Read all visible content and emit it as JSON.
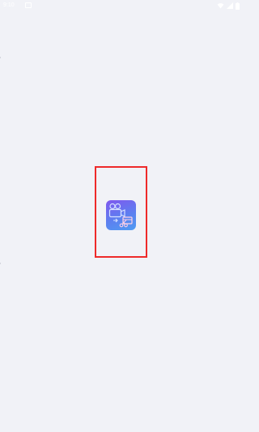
{
  "status_bar": {
    "time": "9:10",
    "icons": [
      "notification-icon",
      "wifi-icon",
      "cellular-signal-icon",
      "battery-icon"
    ]
  },
  "splash": {
    "app_icon": "video-editor-app-icon",
    "highlight_color": "#ee2a2a",
    "background": "#f1f2f7",
    "icon_gradient": [
      "#7f58ee",
      "#4f9cf2"
    ]
  }
}
